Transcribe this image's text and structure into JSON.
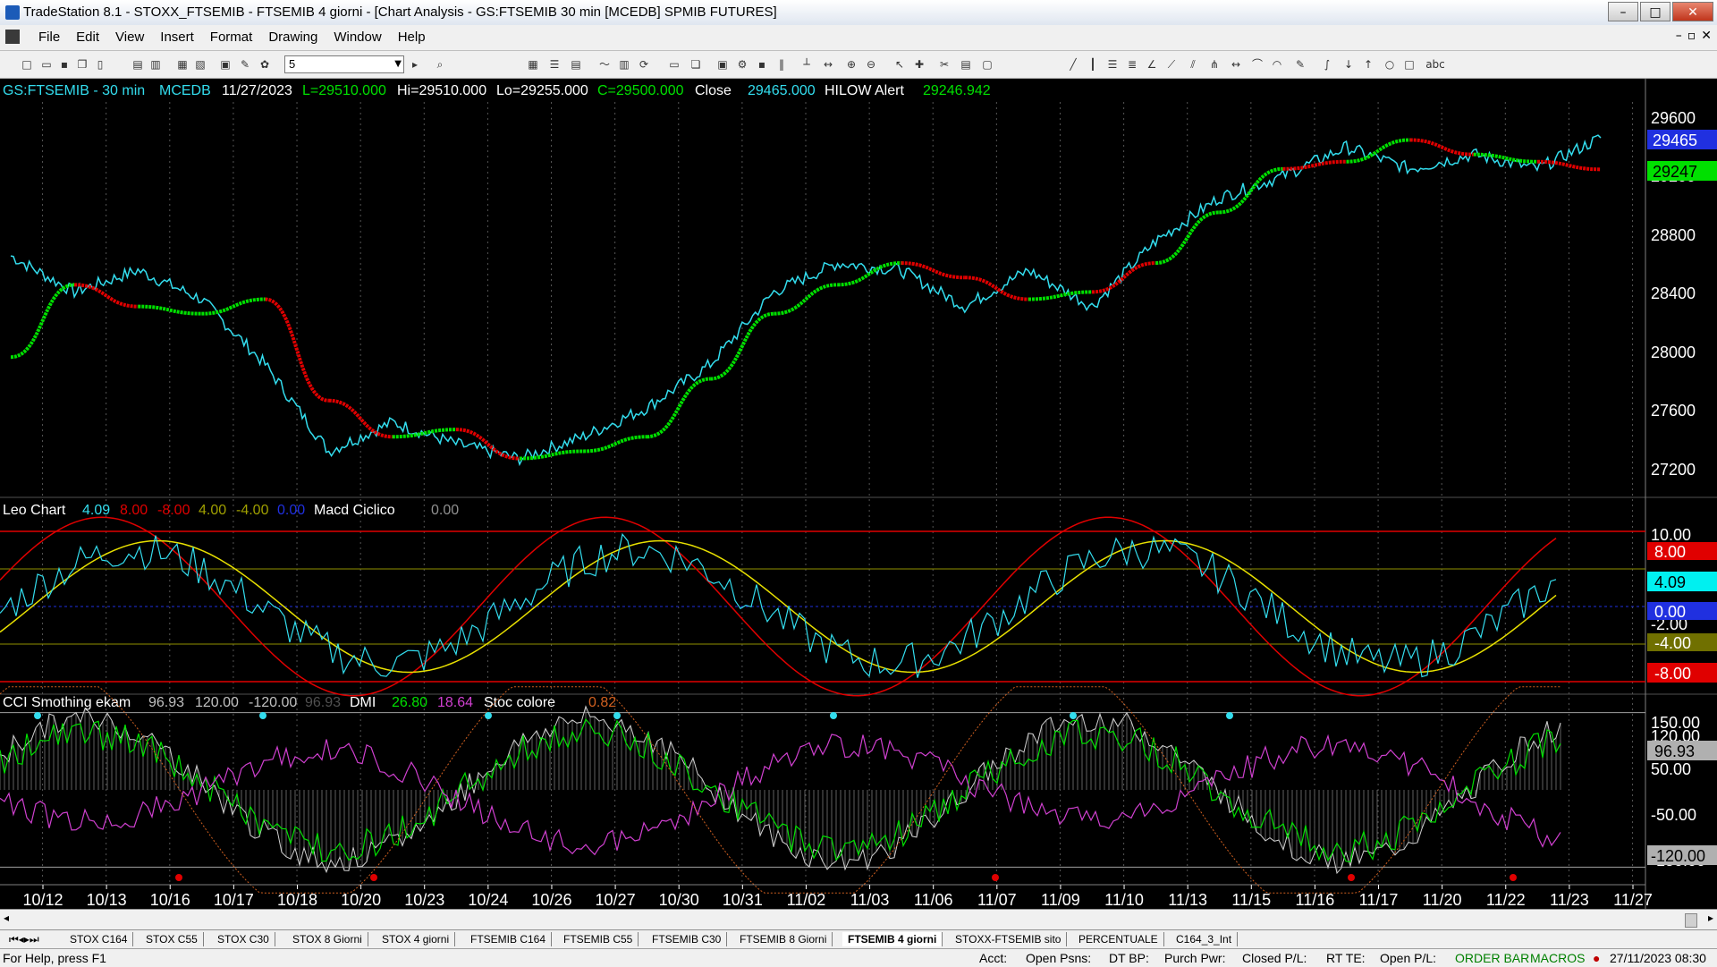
{
  "window": {
    "title": "TradeStation 8.1 - STOXX_FTSEMIB - FTSEMIB 4 giorni - [Chart Analysis - GS:FTSEMIB 30 min [MCEDB] SPMIB FUTURES]",
    "minimize": "–",
    "maximize": "□",
    "close": "✕"
  },
  "menu": {
    "items": [
      "File",
      "Edit",
      "View",
      "Insert",
      "Format",
      "Drawing",
      "Window",
      "Help"
    ],
    "mdi_min": "–",
    "mdi_restore": "▫",
    "mdi_close": "✕"
  },
  "toolbar": {
    "interval_value": "5"
  },
  "chart": {
    "header": {
      "symbol": "GS:FTSEMIB - 30 min",
      "feed": "MCEDB",
      "date": "11/27/2023",
      "low_label": "L=29510.000",
      "high_label": "Hi=29510.000",
      "lo_label": "Lo=29255.000",
      "close_label": "C=29500.000",
      "close_word": "Close",
      "close_value": "29465.000",
      "indicator": "HILOW Alert",
      "indicator_value": "29246.942"
    },
    "price_axis": {
      "ticks": [
        "29600",
        "29200",
        "28800",
        "28400",
        "28000",
        "27600",
        "27200"
      ],
      "last_price_badge": "29465",
      "alert_badge": "29247"
    },
    "pane2": {
      "title": "Leo Chart",
      "v1": "4.09",
      "v2": "8.00",
      "v3": "-8.00",
      "v4": "4.00",
      "v5": "-4.00",
      "v6": "0.00",
      "macd": "Macd Ciclico",
      "macd_val": "0.00",
      "ticks": [
        "10.00",
        "-2.00"
      ],
      "badges": [
        "8.00",
        "4.09",
        "0.00",
        "-4.00",
        "-8.00"
      ]
    },
    "pane3": {
      "title": "CCI Smothing ekam",
      "v1": "96.93",
      "v2": "120.00",
      "v3": "-120.00",
      "v4": "96.93",
      "dmi": "DMI",
      "dmi1": "26.80",
      "dmi2": "18.64",
      "stoc": "Stoc colore",
      "stoc_val": "0.82",
      "ticks": [
        "150.00",
        "120.00",
        "50.00",
        "-50.00",
        "-150.00"
      ],
      "badges": [
        "96.93",
        "-120.00"
      ]
    },
    "x_axis": [
      "10/12",
      "10/13",
      "10/16",
      "10/17",
      "10/18",
      "10/20",
      "10/23",
      "10/24",
      "10/26",
      "10/27",
      "10/30",
      "10/31",
      "11/02",
      "11/03",
      "11/06",
      "11/07",
      "11/09",
      "11/10",
      "11/13",
      "11/15",
      "11/16",
      "11/17",
      "11/20",
      "11/22",
      "11/23",
      "11/27"
    ]
  },
  "colors": {
    "price": "#33ddee",
    "hilo_up": "#00e000",
    "hilo_down": "#e00000",
    "yellow": "#e8e000",
    "magenta": "#d040d0",
    "orange": "#d06020"
  },
  "chart_data": {
    "type": "line",
    "x": [
      "10/12",
      "10/13",
      "10/16",
      "10/17",
      "10/18",
      "10/20",
      "10/23",
      "10/24",
      "10/26",
      "10/27",
      "10/30",
      "10/31",
      "11/02",
      "11/03",
      "11/06",
      "11/07",
      "11/09",
      "11/10",
      "11/13",
      "11/15",
      "11/16",
      "11/17",
      "11/20",
      "11/22",
      "11/23",
      "11/27"
    ],
    "series": [
      {
        "values": [
          28650,
          28400,
          28550,
          28350,
          27900,
          27300,
          27500,
          27350,
          27250,
          27400,
          27600,
          27900,
          28400,
          28600,
          28550,
          28300,
          28550,
          28300,
          28750,
          29050,
          29200,
          29400,
          29250,
          29350,
          29250,
          29465
        ]
      },
      {
        "values": [
          27950,
          28450,
          28300,
          28250,
          28350,
          27650,
          27400,
          27450,
          27250,
          27300,
          27400,
          27800,
          28250,
          28450,
          28600,
          28500,
          28350,
          28400,
          28600,
          28950,
          29250,
          29300,
          29450,
          29350,
          29300,
          29247
        ]
      }
    ],
    "ylim": [
      27000,
      29700
    ]
  }
}
